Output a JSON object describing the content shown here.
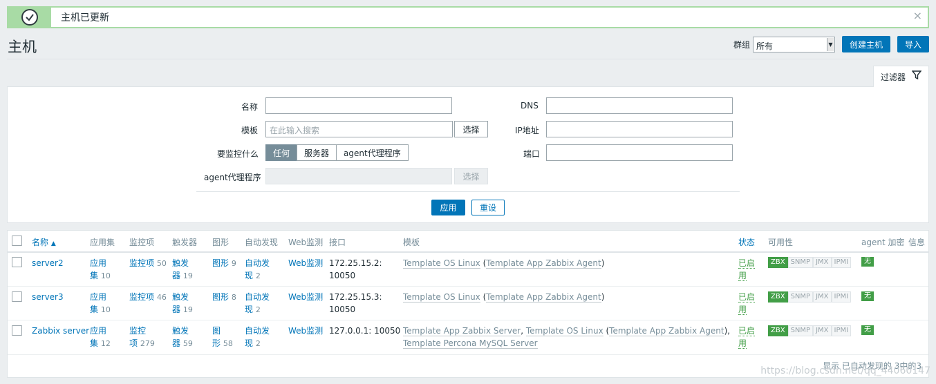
{
  "message": {
    "text": "主机已更新",
    "close": "×"
  },
  "header": {
    "title": "主机",
    "group_label": "群组",
    "group_value": "所有",
    "create_button": "创建主机",
    "import_button": "导入"
  },
  "filter": {
    "tab_label": "过滤器",
    "name_label": "名称",
    "template_label": "模板",
    "template_placeholder": "在此输入搜索",
    "select_button": "选择",
    "monitor_label": "要监控什么",
    "monitor_options": [
      "任何",
      "服务器",
      "agent代理程序"
    ],
    "proxy_label": "agent代理程序",
    "proxy_select": "选择",
    "dns_label": "DNS",
    "ip_label": "IP地址",
    "port_label": "端口",
    "apply_button": "应用",
    "reset_button": "重设"
  },
  "table": {
    "headers": {
      "name": "名称",
      "apps": "应用集",
      "items": "监控项",
      "triggers": "触发器",
      "graphs": "图形",
      "discovery": "自动发现",
      "web": "Web监测",
      "interface": "接口",
      "templates": "模板",
      "status": "状态",
      "availability": "可用性",
      "encryption": "agent 加密",
      "info": "信息"
    },
    "rows": [
      {
        "name": "server2",
        "apps_a": "应用",
        "apps_b": "集",
        "apps_count": "10",
        "items": "监控项",
        "items_count": "50",
        "trig_a": "触发",
        "trig_b": "器",
        "trig_count": "19",
        "graphs": "图形",
        "graphs_count": "9",
        "disc_a": "自动发",
        "disc_b": "现",
        "disc_count": "2",
        "web": "Web监测",
        "iface_a": "172.25.15.2:",
        "iface_b": "10050",
        "tpl1": "Template OS Linux",
        "tpl2": "Template App Zabbix Agent",
        "status_a": "已启",
        "status_b": "用",
        "encryption": "无"
      },
      {
        "name": "server3",
        "apps_a": "应用",
        "apps_b": "集",
        "apps_count": "10",
        "items": "监控项",
        "items_count": "46",
        "trig_a": "触发",
        "trig_b": "器",
        "trig_count": "19",
        "graphs": "图形",
        "graphs_count": "8",
        "disc_a": "自动发",
        "disc_b": "现",
        "disc_count": "2",
        "web": "Web监测",
        "iface_a": "172.25.15.3:",
        "iface_b": "10050",
        "tpl1": "Template OS Linux",
        "tpl2": "Template App Zabbix Agent",
        "status_a": "已启",
        "status_b": "用",
        "encryption": "无"
      },
      {
        "name": "Zabbix server",
        "apps_a": "应用",
        "apps_b": "集",
        "apps_count": "12",
        "items_a": "监控",
        "items_b": "项",
        "items_count": "279",
        "trig_a": "触发",
        "trig_b": "器",
        "trig_count": "59",
        "graphs_a": "图",
        "graphs_b": "形",
        "graphs_count": "58",
        "disc_a": "自动发",
        "disc_b": "现",
        "disc_count": "2",
        "web": "Web监测",
        "iface": "127.0.0.1: 10050",
        "tpl0": "Template App Zabbix Server",
        "tpl1": "Template OS Linux",
        "tpl2": "Template App Zabbix Agent",
        "tpl3": "Template Percona MySQL Server",
        "status_a": "已启",
        "status_b": "用",
        "encryption": "无"
      }
    ],
    "availability_labels": [
      "ZBX",
      "SNMP",
      "JMX",
      "IPMI"
    ],
    "footer": "显示 已自动发现的 3中的3"
  },
  "watermark": "https://blog.csdn.net/qq_44060147",
  "colors": {
    "accent": "#0275b8",
    "success": "#429e47",
    "banner": "#a8dba5"
  }
}
